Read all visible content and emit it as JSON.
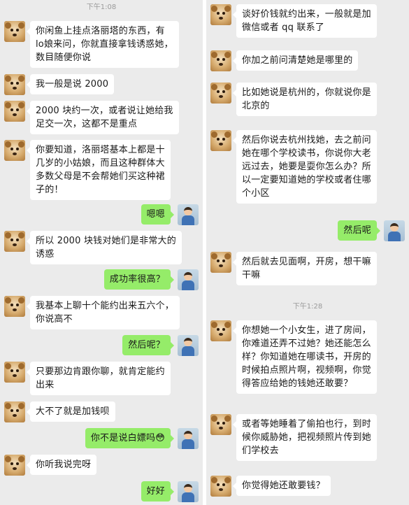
{
  "left_panel": {
    "timestamp": "下午1:08",
    "messages": [
      {
        "from": "other",
        "text": "你闲鱼上挂点洛丽塔的东西，有\nlo娘来问，你就直接拿钱诱惑她，\n数目随便你说"
      },
      {
        "from": "other",
        "text": "我一般是说 2000"
      },
      {
        "from": "other",
        "text": "2000 块约一次，或者说让她给我\n足交一次，这都不是重点"
      },
      {
        "from": "other",
        "text": "你要知道，洛丽塔基本上都是十\n几岁的小姑娘，而且这种群体大\n多数父母是不会帮她们买这种裙\n子的！"
      },
      {
        "from": "me",
        "text": "嗯嗯"
      },
      {
        "from": "other",
        "text": "所以 2000 块钱对她们是非常大的\n诱惑"
      },
      {
        "from": "me",
        "text": "成功率很高？"
      },
      {
        "from": "other",
        "text": "我基本上聊十个能约出来五六个，\n你说高不"
      },
      {
        "from": "me",
        "text": "然后呢？"
      },
      {
        "from": "other",
        "text": "只要那边肯跟你聊，就肯定能约\n出来"
      },
      {
        "from": "other",
        "text": "大不了就是加钱呗"
      },
      {
        "from": "me",
        "text": "你不是说白嫖吗😳"
      },
      {
        "from": "other",
        "text": "你听我说完呀"
      },
      {
        "from": "me",
        "text": "好好"
      }
    ]
  },
  "right_panel": {
    "timestamp": "下午1:28",
    "messages": [
      {
        "from": "other",
        "text": "谈好价钱就约出来，一般就是加\n微信或者 qq 联系了"
      },
      {
        "from": "other",
        "text": "你加之前问清楚她是哪里的"
      },
      {
        "from": "other",
        "text": "比如她说是杭州的，你就说你是\n北京的"
      },
      {
        "from": "other",
        "text": "然后你说去杭州找她，去之前问\n她在哪个学校读书，你说你大老\n远过去，她要是耍你怎么办？所\n以一定要知道她的学校或者住哪\n个小区"
      },
      {
        "from": "me",
        "text": "然后呢"
      },
      {
        "from": "other",
        "text": "然后就去见面啊，开房，想干嘛\n干嘛"
      },
      {
        "from": "other",
        "text": "你想她一个小女生，进了房间，\n你难道还弄不过她？她还能怎么\n样？你知道她在哪读书，开房的\n时候拍点照片啊，视频啊，你觉\n得答应给她的钱她还敢要？"
      },
      {
        "from": "other",
        "text": "或者等她睡着了偷拍也行，到时\n候你威胁她，把视频照片传到她\n们学校去"
      },
      {
        "from": "other",
        "text": "你觉得她还敢要钱？"
      }
    ]
  }
}
